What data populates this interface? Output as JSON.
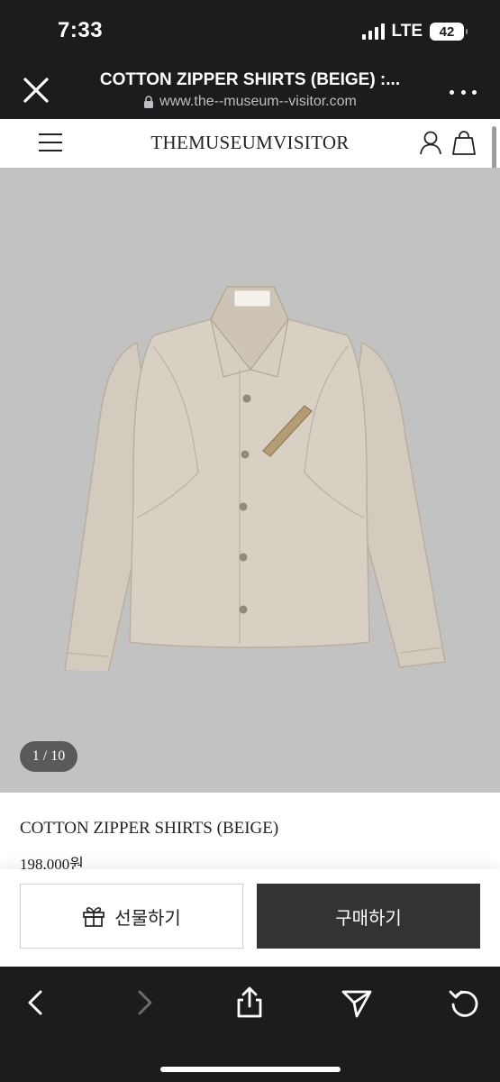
{
  "status_bar": {
    "time": "7:33",
    "network": "LTE",
    "battery": "42"
  },
  "browser": {
    "title": "COTTON ZIPPER SHIRTS (BEIGE) :...",
    "url": "www.the--museum--visitor.com"
  },
  "site": {
    "logo": "THEMUSEUMVISITOR"
  },
  "gallery": {
    "pager": "1 / 10",
    "background_color": "#c2c2c2"
  },
  "product": {
    "name": "COTTON ZIPPER SHIRTS (BEIGE)",
    "price": "198,000원"
  },
  "actions": {
    "gift_label": "선물하기",
    "purchase_label": "구매하기"
  },
  "toolbar": {
    "icons": [
      "back-icon",
      "forward-icon",
      "share-icon",
      "send-icon",
      "reload-icon"
    ]
  }
}
